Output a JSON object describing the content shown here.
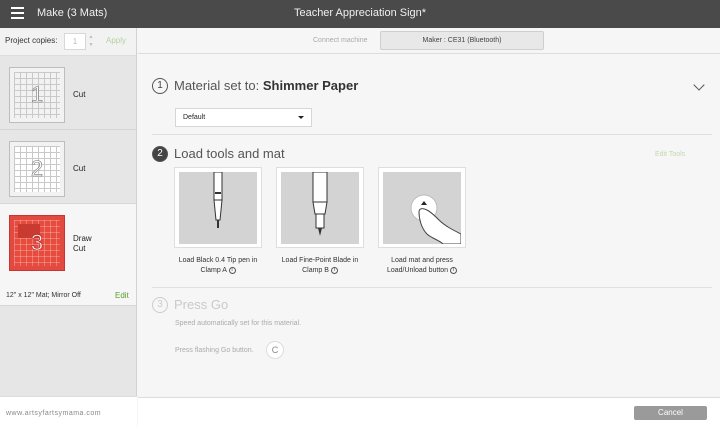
{
  "header": {
    "make_title": "Make (3 Mats)",
    "doc_title": "Teacher Appreciation Sign*"
  },
  "sidebar": {
    "copies_label": "Project copies:",
    "copies_value": "1",
    "apply_label": "Apply",
    "mats": [
      {
        "number": "1",
        "label": "Cut"
      },
      {
        "number": "2",
        "label": "Cut"
      },
      {
        "number": "3",
        "label_line1": "Draw",
        "label_line2": "Cut",
        "sub": "12\" x 12\" Mat; Mirror Off",
        "edit_label": "Edit"
      }
    ],
    "watermark": "www.artsyfartsymama.com"
  },
  "connect": {
    "label": "Connect machine",
    "machine": "Maker : CE31 (Bluetooth)"
  },
  "step1": {
    "number": "1",
    "title_prefix": "Material set to:",
    "material": "Shimmer Paper",
    "select_value": "Default"
  },
  "step2": {
    "number": "2",
    "title": "Load tools and mat",
    "edit_tools": "Edit Tools",
    "tools": [
      {
        "line1": "Load Black 0.4 Tip pen in",
        "line2": "Clamp A"
      },
      {
        "line1": "Load Fine-Point Blade in",
        "line2": "Clamp B"
      },
      {
        "line1": "Load mat and press",
        "line2": "Load/Unload button"
      }
    ]
  },
  "step3": {
    "number": "3",
    "title": "Press Go",
    "speed_note": "Speed automatically set for this material.",
    "press_note": "Press flashing Go button."
  },
  "footer": {
    "cancel_label": "Cancel"
  },
  "icons": {
    "info": "i",
    "go": "C"
  }
}
